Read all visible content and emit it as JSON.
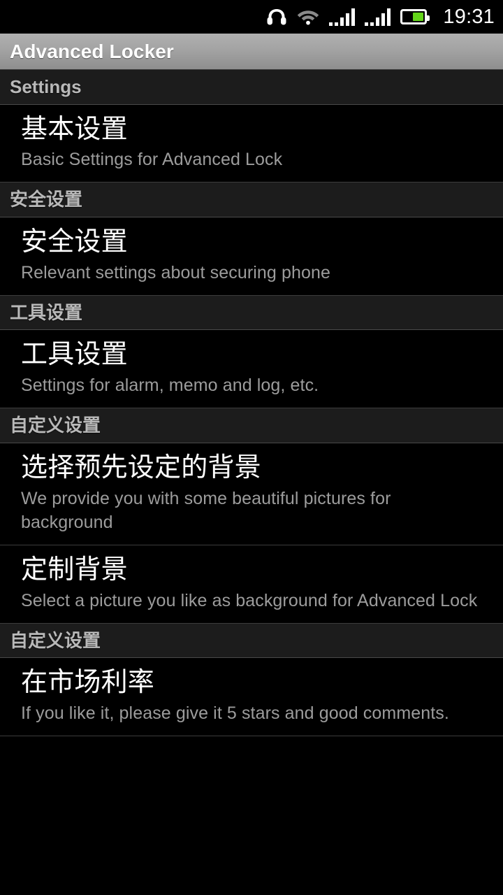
{
  "status_bar": {
    "icons": [
      {
        "name": "headphones-icon",
        "label": "headphones"
      },
      {
        "name": "wifi-icon",
        "label": "wifi"
      },
      {
        "name": "signal-icon-sim1",
        "label": "signal-sim1"
      },
      {
        "name": "signal-icon-sim2",
        "label": "signal-sim2"
      },
      {
        "name": "battery-icon",
        "label": "battery"
      }
    ],
    "clock": "19:31",
    "battery_level_percent": 54,
    "battery_fill_color": "#63d419",
    "icon_color": "#ffffff",
    "wifi_color": "#8a8a8a"
  },
  "titlebar": {
    "title": "Advanced Locker",
    "text_color": "#ffffff",
    "background_top": "#b0b0b0",
    "background_bottom": "#8e8e8e"
  },
  "colors": {
    "screen_background": "#000000",
    "section_header_background": "#1c1c1c",
    "section_header_text": "#b9b9b9",
    "item_title_text": "#ffffff",
    "item_subtitle_text": "#9c9c9c",
    "divider": "#3c3c3c",
    "section_divider": "#4a4a4a"
  },
  "sections": [
    {
      "header": "Settings",
      "items": [
        {
          "title": "基本设置",
          "subtitle": "Basic Settings for Advanced Lock"
        }
      ]
    },
    {
      "header": "安全设置",
      "items": [
        {
          "title": "安全设置",
          "subtitle": "Relevant settings about securing phone"
        }
      ]
    },
    {
      "header": "工具设置",
      "items": [
        {
          "title": "工具设置",
          "subtitle": "Settings for alarm, memo and log, etc."
        }
      ]
    },
    {
      "header": "自定义设置",
      "items": [
        {
          "title": "选择预先设定的背景",
          "subtitle": "We provide you with some beautiful pictures for background"
        },
        {
          "title": "定制背景",
          "subtitle": "Select a picture you like as background for Advanced Lock"
        }
      ]
    },
    {
      "header": "自定义设置",
      "items": [
        {
          "title": "在市场利率",
          "subtitle": "If you like it, please give it 5 stars and good comments."
        }
      ]
    }
  ]
}
